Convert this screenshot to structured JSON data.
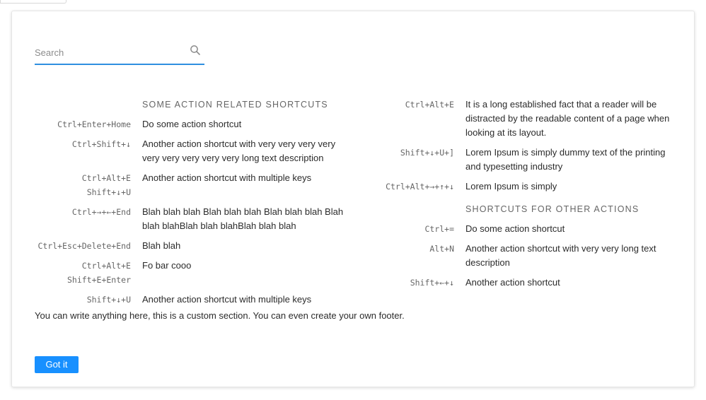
{
  "search": {
    "placeholder": "Search",
    "value": ""
  },
  "left_group": {
    "title": "SOME ACTION RELATED SHORTCUTS",
    "rows": [
      {
        "keys": [
          "Ctrl+Enter+Home"
        ],
        "desc": "Do some action shortcut"
      },
      {
        "keys": [
          "Ctrl+Shift+↓"
        ],
        "desc": "Another action shortcut with very very very very very very very very very long text description"
      },
      {
        "keys": [
          "Ctrl+Alt+E",
          "Shift+↓+U"
        ],
        "desc": "Another action shortcut with multiple keys"
      },
      {
        "keys": [
          "Ctrl+→+←+End"
        ],
        "desc": "Blah blah blah Blah blah blah Blah blah blah Blah blah blahBlah blah blahBlah blah blah"
      },
      {
        "keys": [
          "Ctrl+Esc+Delete+End"
        ],
        "desc": "Blah blah"
      },
      {
        "keys": [
          "Ctrl+Alt+E",
          "Shift+E+Enter"
        ],
        "desc": "Fo bar cooo"
      },
      {
        "keys": [
          "Shift+↓+U"
        ],
        "desc": "Another action shortcut with multiple keys"
      }
    ]
  },
  "right_top": {
    "rows": [
      {
        "keys": [
          "Ctrl+Alt+E"
        ],
        "desc": "It is a long established fact that a reader will be distracted by the readable content of a page when looking at its layout."
      },
      {
        "keys": [
          "Shift+↓+U+]"
        ],
        "desc": "Lorem Ipsum is simply dummy text of the printing and typesetting industry"
      },
      {
        "keys": [
          "Ctrl+Alt+→+↑+↓"
        ],
        "desc": "Lorem Ipsum is simply"
      }
    ]
  },
  "right_group": {
    "title": "SHORTCUTS FOR OTHER ACTIONS",
    "rows": [
      {
        "keys": [
          "Ctrl+="
        ],
        "desc": "Do some action shortcut"
      },
      {
        "keys": [
          "Alt+N"
        ],
        "desc": "Another action shortcut with very very long text description"
      },
      {
        "keys": [
          "Shift+←+↓"
        ],
        "desc": "Another action shortcut"
      }
    ]
  },
  "footer": {
    "text": "You can write anything here, this is a custom section. You can even create your own footer.",
    "button_label": "Got it"
  },
  "colors": {
    "accent": "#1890ff",
    "underline": "#2f8fe0"
  },
  "icons": {
    "search": "search-icon"
  }
}
